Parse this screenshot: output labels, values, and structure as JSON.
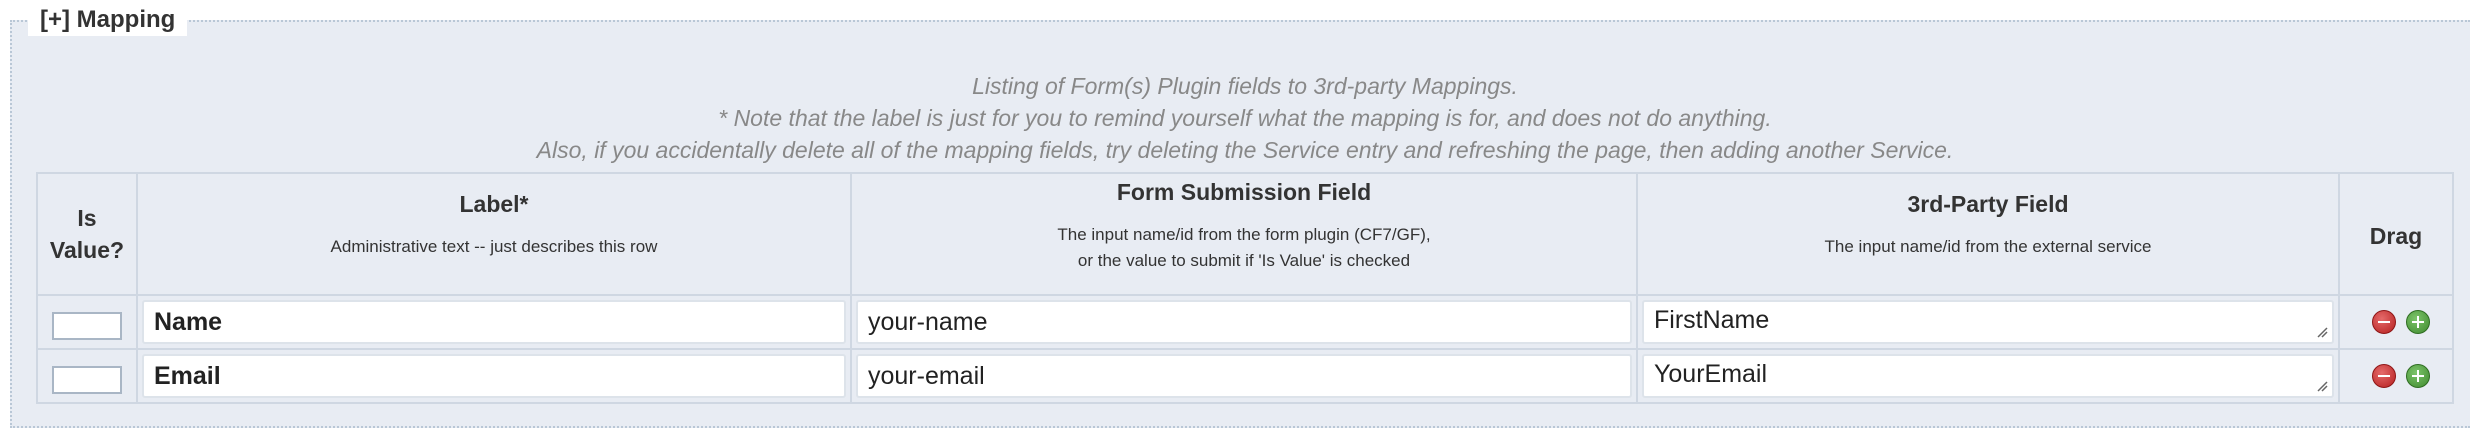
{
  "fieldset": {
    "legend": "[+] Mapping"
  },
  "intro": {
    "line1": "Listing of Form(s) Plugin fields to 3rd-party Mappings.",
    "line2": "* Note that the label is just for you to remind yourself what the mapping is for, and does not do anything.",
    "line3": "Also, if you accidentally delete all of the mapping fields, try deleting the Service entry and refreshing the page, then adding another Service."
  },
  "table": {
    "headers": {
      "is_value_1": "Is",
      "is_value_2": "Value?",
      "label_title": "Label*",
      "label_sub": "Administrative text -- just describes this row",
      "form_title": "Form Submission Field",
      "form_sub_1": "The input name/id from the form plugin (CF7/GF),",
      "form_sub_2": "or the value to submit if 'Is Value' is checked",
      "third_title": "3rd-Party Field",
      "third_sub": "The input name/id from the external service",
      "drag": "Drag"
    },
    "rows": [
      {
        "label": "Name",
        "form_field": "your-name",
        "third_party": "FirstName"
      },
      {
        "label": "Email",
        "form_field": "your-email",
        "third_party": "YourEmail"
      }
    ]
  },
  "icons": {
    "remove": "minus-circle-icon",
    "add": "plus-circle-icon",
    "resize": "resize-grip-icon"
  },
  "colors": {
    "panel_bg": "#e8ecf3",
    "remove_red": "#c22",
    "add_green": "#4a9a36"
  }
}
